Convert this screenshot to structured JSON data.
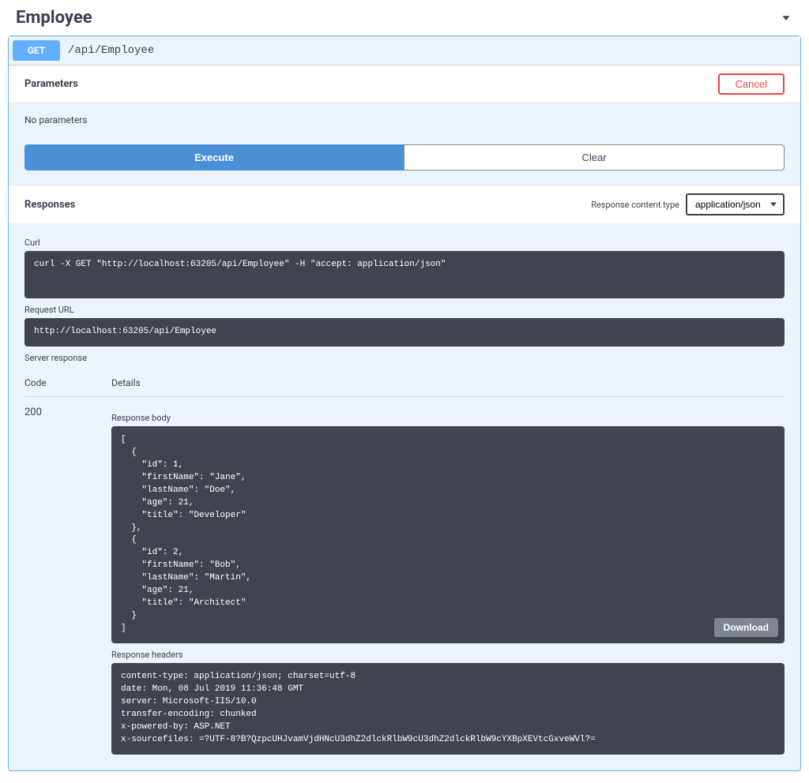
{
  "header": {
    "title": "Employee"
  },
  "operation": {
    "method": "GET",
    "path": "/api/Employee"
  },
  "parameters": {
    "heading": "Parameters",
    "cancel_label": "Cancel",
    "empty_text": "No parameters"
  },
  "actions": {
    "execute": "Execute",
    "clear": "Clear"
  },
  "responses": {
    "heading": "Responses",
    "content_type_label": "Response content type",
    "content_type_value": "application/json"
  },
  "curl": {
    "label": "Curl",
    "command": "curl -X GET \"http://localhost:63205/api/Employee\" -H \"accept: application/json\""
  },
  "request_url": {
    "label": "Request URL",
    "value": "http://localhost:63205/api/Employee"
  },
  "server_response": {
    "label": "Server response",
    "code_header": "Code",
    "details_header": "Details",
    "status_code": "200",
    "response_body_label": "Response body",
    "response_body": "[\n  {\n    \"id\": 1,\n    \"firstName\": \"Jane\",\n    \"lastName\": \"Doe\",\n    \"age\": 21,\n    \"title\": \"Developer\"\n  },\n  {\n    \"id\": 2,\n    \"firstName\": \"Bob\",\n    \"lastName\": \"Martin\",\n    \"age\": 21,\n    \"title\": \"Architect\"\n  }\n]",
    "download_label": "Download",
    "response_headers_label": "Response headers",
    "response_headers": "content-type: application/json; charset=utf-8\ndate: Mon, 08 Jul 2019 11:36:48 GMT\nserver: Microsoft-IIS/10.0\ntransfer-encoding: chunked\nx-powered-by: ASP.NET\nx-sourcefiles: =?UTF-8?B?QzpcUHJvamVjdHNcU3dhZ2dlckRlbW9cU3dhZ2dlckRlbW9cYXBpXEVtcGxveWVl?="
  }
}
